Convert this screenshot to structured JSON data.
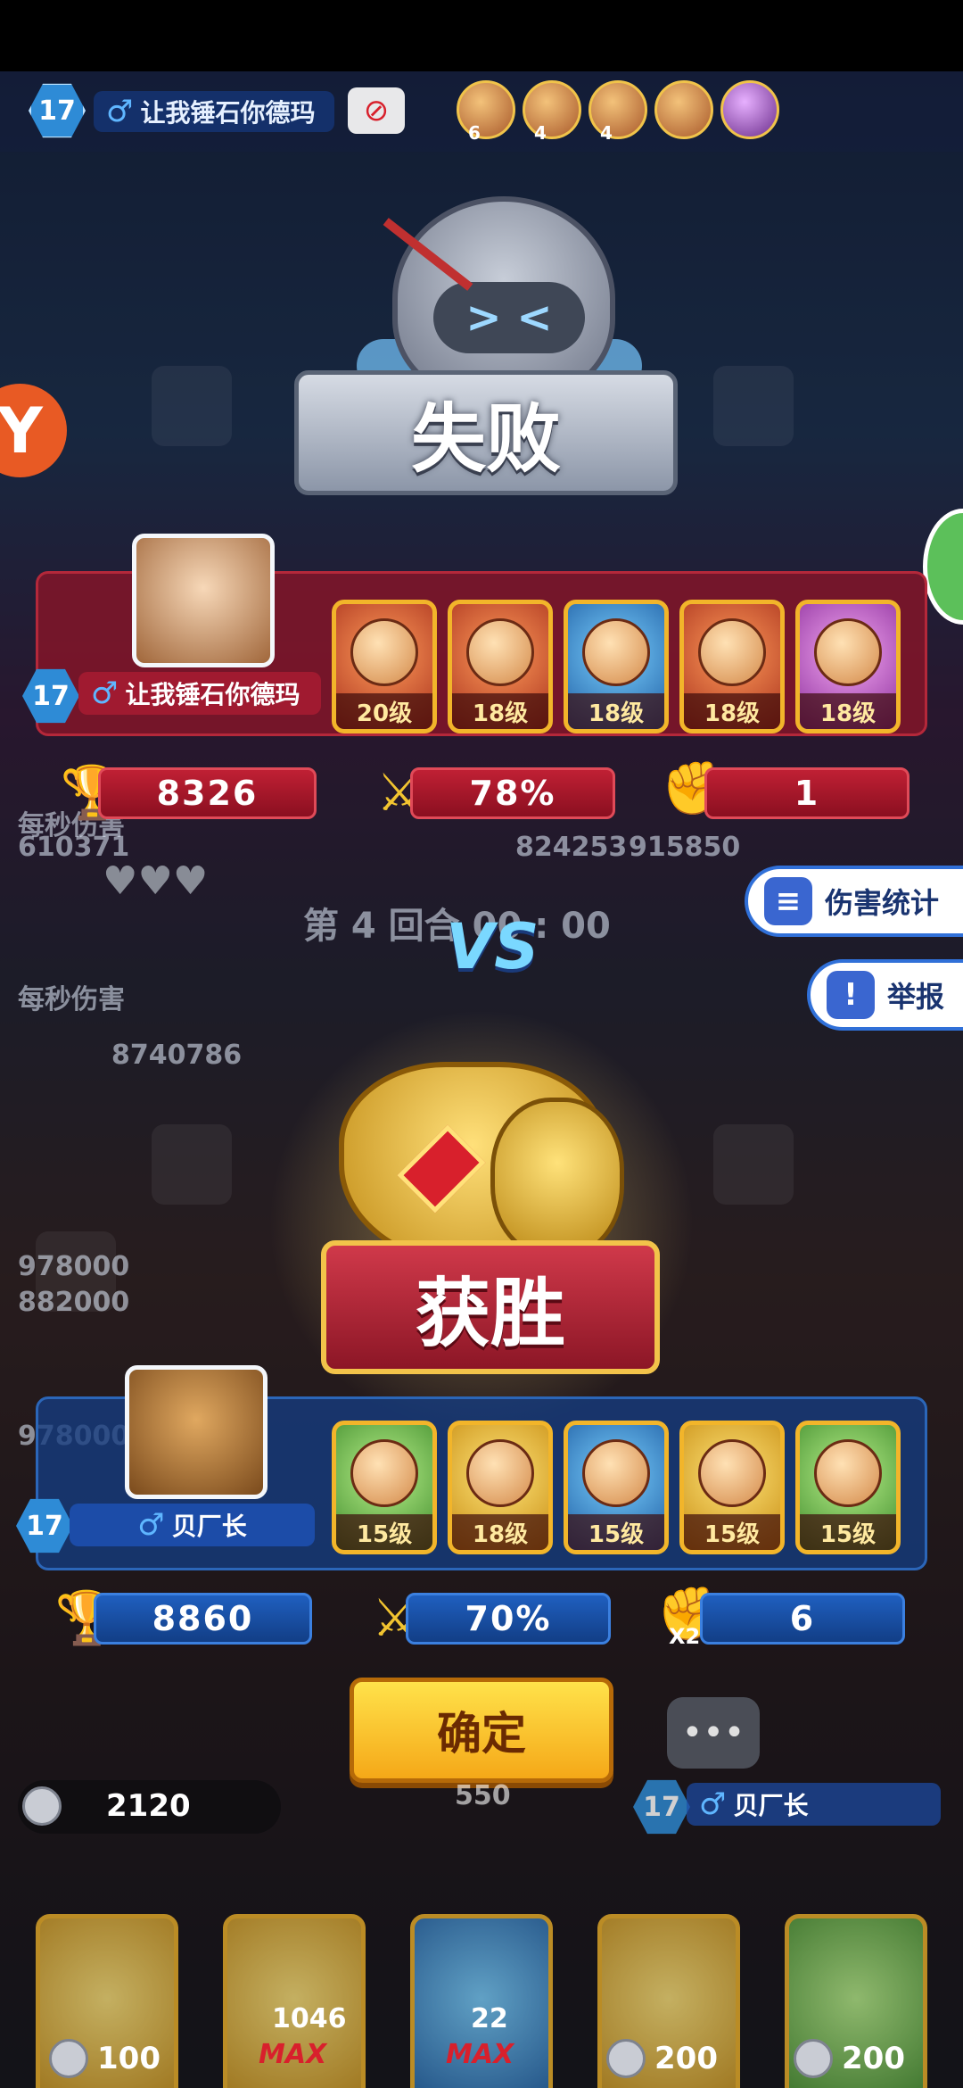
{
  "top_bar": {
    "player_level": "17",
    "player_name": "让我锤石你德玛",
    "mini_heroes": [
      {
        "icon": "hero-portrait-icon",
        "stars": "6"
      },
      {
        "icon": "hero-portrait-icon",
        "stars": "4"
      },
      {
        "icon": "hero-portrait-icon",
        "stars": "4"
      },
      {
        "icon": "hero-portrait-icon",
        "stars": ""
      },
      {
        "icon": "hero-portrait-icon",
        "stars": ""
      }
    ]
  },
  "defeat": {
    "label": "失败",
    "player_level": "17",
    "player_name": "让我锤石你德玛",
    "heroes": [
      {
        "level": "20级"
      },
      {
        "level": "18级"
      },
      {
        "level": "18级"
      },
      {
        "level": "18级"
      },
      {
        "level": "18级"
      }
    ],
    "trophies": "8326",
    "win_rate": "78%",
    "fist_count": "1"
  },
  "middle": {
    "vs": "VS",
    "round_text": "第 4 回合 00 : 00",
    "dps_top": "每秒伤害",
    "dps_bottom": "每秒伤害",
    "bg_numbers": [
      "610371",
      "824253",
      "915850",
      "8740786",
      "978000",
      "882000",
      "978000"
    ]
  },
  "side_buttons": {
    "damage_stats": "伤害统计",
    "report": "举报"
  },
  "victory": {
    "label": "获胜",
    "player_level": "17",
    "player_name": "贝厂长",
    "heroes": [
      {
        "level": "15级"
      },
      {
        "level": "18级"
      },
      {
        "level": "15级"
      },
      {
        "level": "15级"
      },
      {
        "level": "15级"
      }
    ],
    "trophies": "8860",
    "win_rate": "70%",
    "fist_multiplier": "X2",
    "fist_count": "6"
  },
  "confirm_button": "确定",
  "bottom": {
    "coins": "2120",
    "center_cost": "550",
    "player_level": "17",
    "player_name": "贝厂长",
    "card_stats": [
      "1046",
      "22"
    ],
    "max_labels": [
      "MAX",
      "MAX"
    ],
    "card_costs": [
      "100",
      "200",
      "200"
    ]
  },
  "colors": {
    "defeat_panel": "#8c1428",
    "victory_panel": "#143c82",
    "confirm_button": "#f5c22a",
    "vs_text": "#7ad8ff"
  }
}
